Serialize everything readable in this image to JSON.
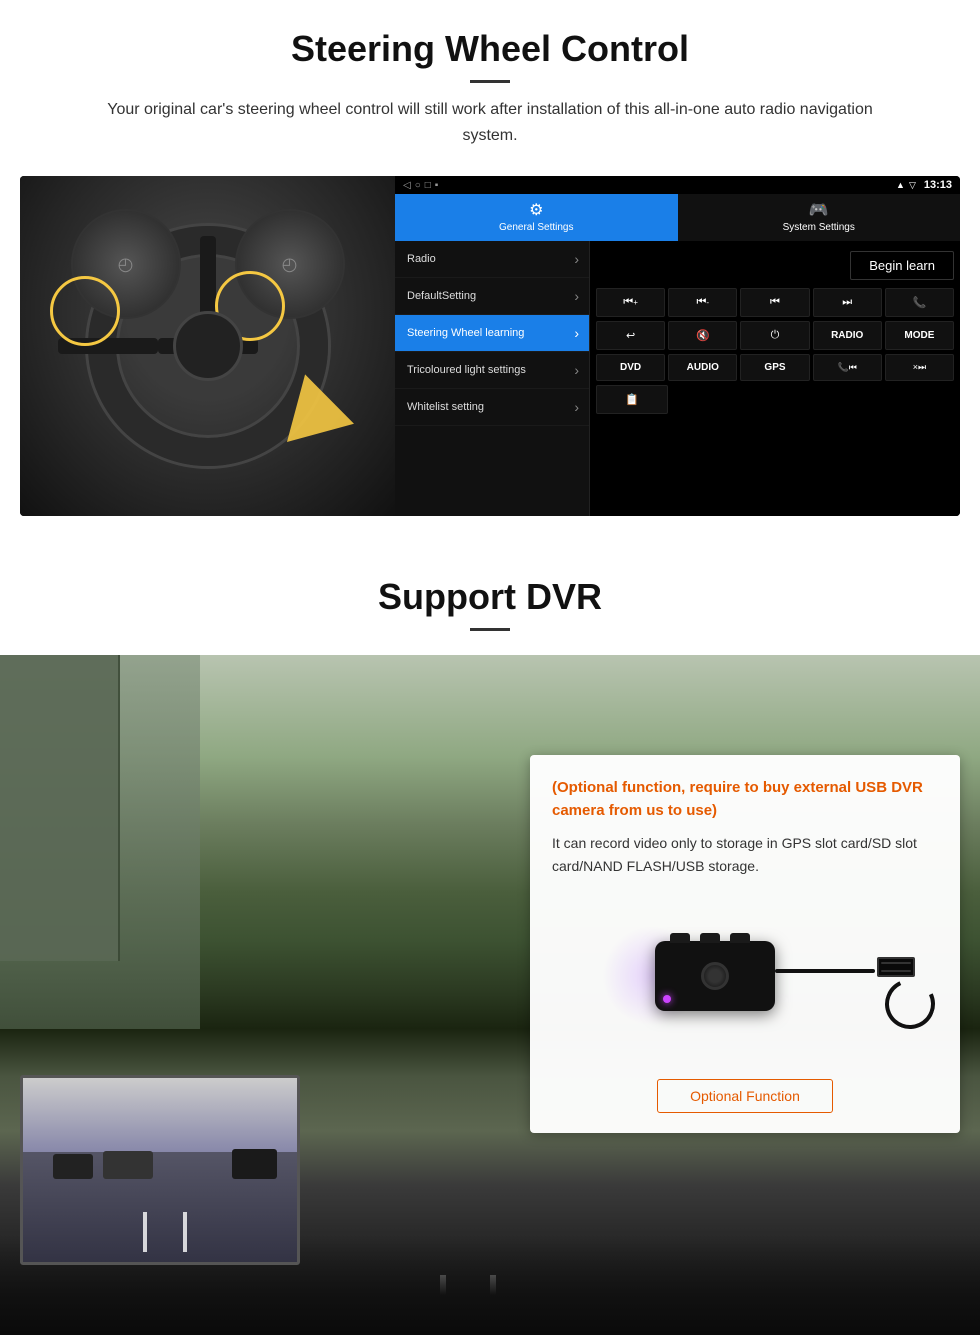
{
  "steering_section": {
    "title": "Steering Wheel Control",
    "subtitle": "Your original car's steering wheel control will still work after installation of this all-in-one auto radio navigation system.",
    "android_ui": {
      "statusbar": {
        "time": "13:13"
      },
      "tabs": [
        {
          "id": "general",
          "icon": "⚙",
          "label": "General Settings",
          "active": true
        },
        {
          "id": "system",
          "icon": "🎮",
          "label": "System Settings",
          "active": false
        }
      ],
      "menu_items": [
        {
          "label": "Radio",
          "active": false
        },
        {
          "label": "DefaultSetting",
          "active": false
        },
        {
          "label": "Steering Wheel learning",
          "active": true
        },
        {
          "label": "Tricoloured light settings",
          "active": false
        },
        {
          "label": "Whitelist setting",
          "active": false
        }
      ],
      "begin_learn_label": "Begin learn",
      "control_buttons": [
        [
          "⏮+",
          "⏮-",
          "⏮⏮",
          "⏭⏭",
          "📞"
        ],
        [
          "↩",
          "🔇×",
          "⏻",
          "RADIO",
          "MODE"
        ],
        [
          "DVD",
          "AUDIO",
          "GPS",
          "📞⏮",
          "×⏭"
        ]
      ]
    }
  },
  "dvr_section": {
    "title": "Support DVR",
    "optional_title": "(Optional function, require to buy external USB DVR camera from us to use)",
    "description": "It can record video only to storage in GPS slot card/SD slot card/NAND FLASH/USB storage.",
    "optional_function_label": "Optional Function"
  }
}
